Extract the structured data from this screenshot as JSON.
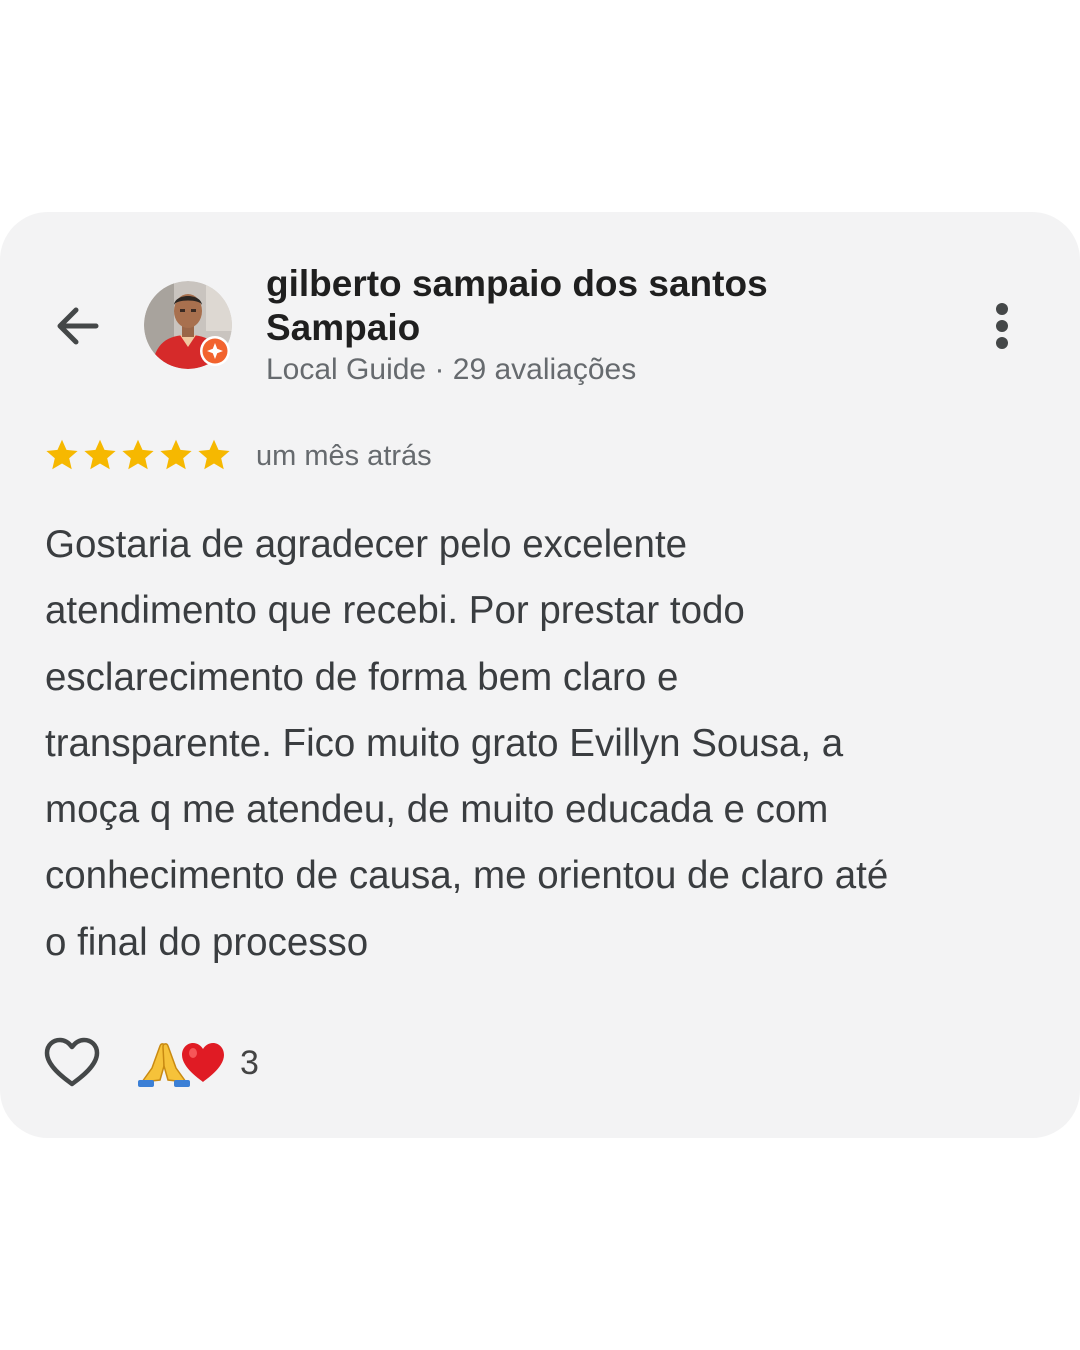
{
  "review": {
    "author_name": "gilberto sampaio dos santos Sampaio",
    "author_meta": "Local Guide · 29 avaliações",
    "rating": 5,
    "rating_max": 5,
    "time_ago": "um mês atrás",
    "text": "Gostaria de agradecer pelo excelente\natendimento que recebi. Por prestar todo\nesclarecimento de forma bem claro e\ntransparente. Fico muito grato Evillyn Sousa, a\nmoça q me atendeu, de muito educada e com\nconhecimento de causa, me orientou de claro até\no final do processo",
    "reactions": {
      "emojis": [
        "folded-hands",
        "red-heart"
      ],
      "count": "3"
    }
  },
  "icons": {
    "back": "arrow-left-icon",
    "more": "more-vertical-icon",
    "like": "heart-outline-icon",
    "badge": "local-guide-badge-icon"
  },
  "colors": {
    "card_bg": "#f3f3f4",
    "star": "#f6b800",
    "badge": "#f2632e",
    "heart": "#e01b24"
  }
}
